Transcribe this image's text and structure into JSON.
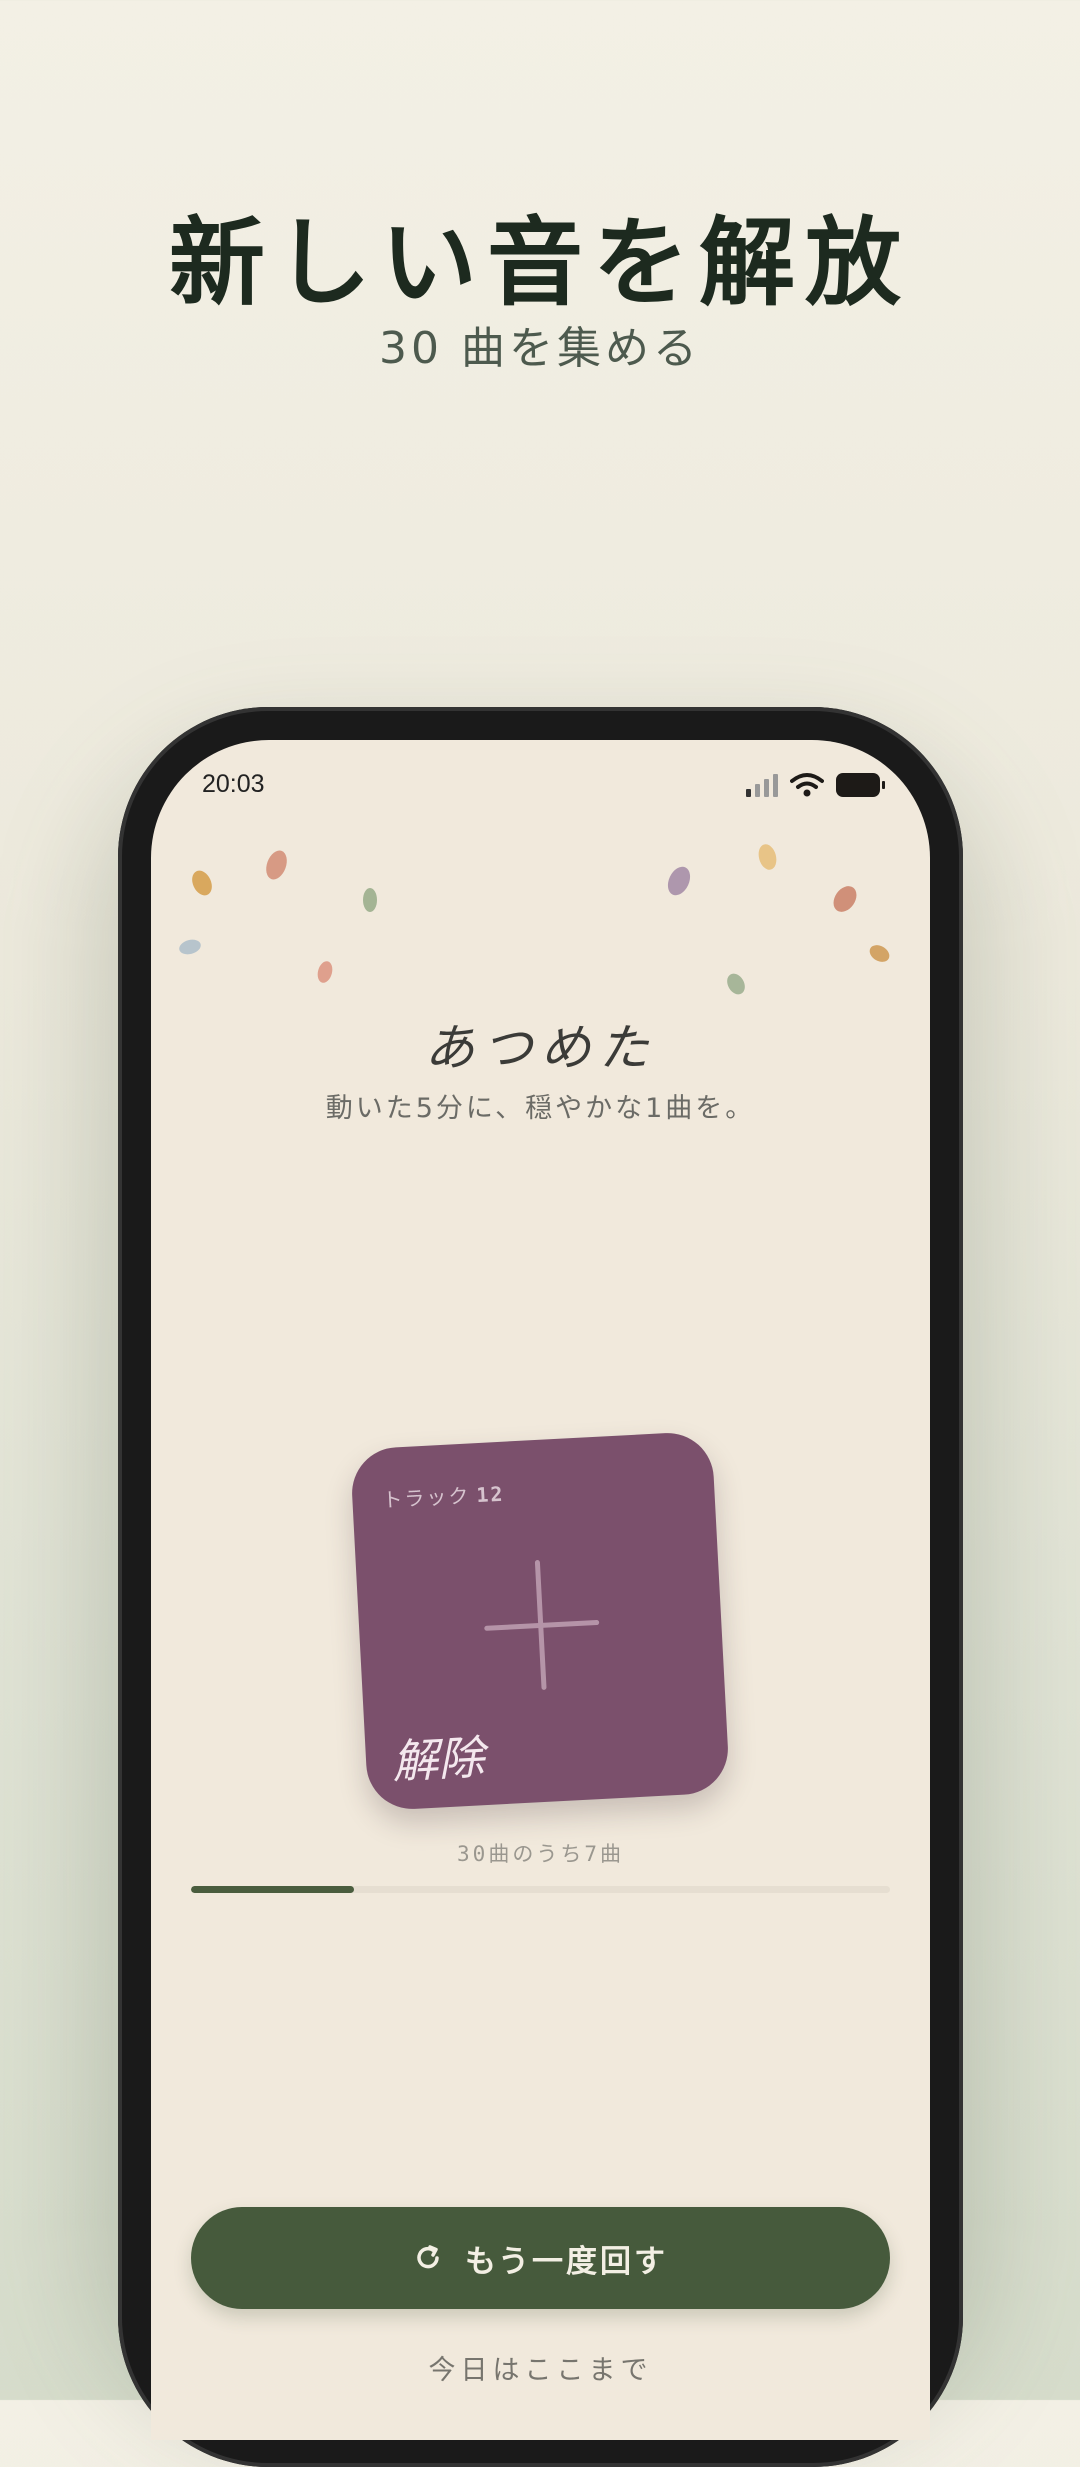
{
  "promo": {
    "title": "新しい音を解放",
    "subtitle": "30 曲を集める"
  },
  "status_bar": {
    "time": "20:03",
    "icons": [
      "signal-icon",
      "wifi-icon",
      "battery-icon"
    ]
  },
  "screen": {
    "heading": "あつめた",
    "subheading": "動いた5分に、穏やかな1曲を。",
    "card": {
      "track_label": "トラック",
      "track_number": "12",
      "label": "解除",
      "color": "#7b506c",
      "icon": "cross-icon"
    },
    "progress": {
      "text": "30曲のうち7曲",
      "collected": 7,
      "total": 30
    },
    "spin_button": {
      "label": "もう一度回す",
      "icon": "refresh-icon"
    },
    "done_label": "今日はここまで"
  },
  "colors": {
    "accent": "#465a3c",
    "card": "#7b506c",
    "screen_bg": "#f1e9dc",
    "text_dark": "#1d2a1f"
  }
}
